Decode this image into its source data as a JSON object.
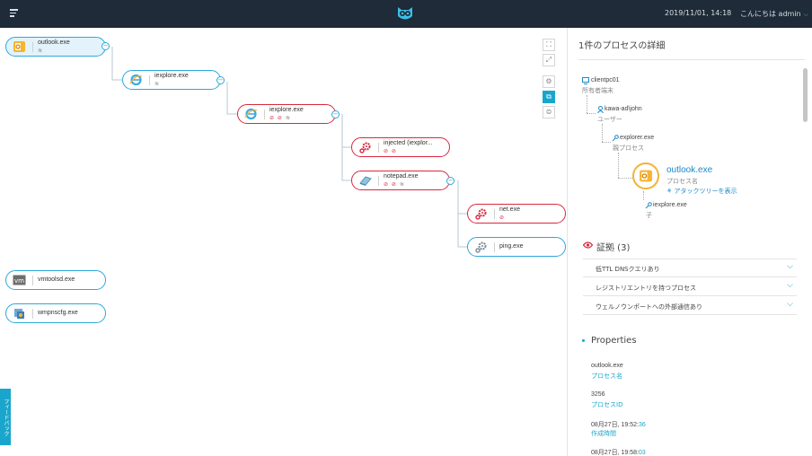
{
  "header": {
    "datetime": "2019/11/01, 14:18",
    "greeting": "こんにちは admin",
    "caret": "⌵"
  },
  "icons": {
    "menu": "menu-icon",
    "logo": "owl-logo-icon",
    "outlook": "outlook-icon",
    "ie": "internet-explorer-icon",
    "gear": "gear-icon",
    "notepad": "notepad-icon",
    "vm": "vm-icon",
    "network": "network-icon",
    "monitor": "monitor-icon",
    "user": "user-icon",
    "key": "key-icon",
    "eye": "eye-icon",
    "tree": "tree-icon"
  },
  "colors": {
    "topbar": "#1f2b38",
    "blue": "#2ba8db",
    "red": "#d8283e",
    "accent": "#1aa6cc",
    "link": "#1a88c9"
  },
  "graph": {
    "nodes": [
      {
        "label": "outlook.exe",
        "badges": ""
      },
      {
        "label": "iexplore.exe",
        "badges": ""
      },
      {
        "label": "iexplore.exe",
        "badges": "⊘ ⊘"
      },
      {
        "label": "injected (iexplor...",
        "badges": "⊘ ⊘"
      },
      {
        "label": "notepad.exe",
        "badges": "⊘ ⊘"
      },
      {
        "label": "net.exe",
        "badges": "⊘"
      },
      {
        "label": "ping.exe",
        "badges": ""
      },
      {
        "label": "vmtoolsd.exe",
        "badges": ""
      },
      {
        "label": "wmpnscfg.exe",
        "badges": ""
      }
    ],
    "collapse_symbol": "−",
    "vm_text": "vm"
  },
  "tools": [
    "⛶",
    "⤢",
    "⚙",
    "⧉",
    "⊜"
  ],
  "feedback": "フィードバック",
  "panel": {
    "title": "1件のプロセスの詳細",
    "host": {
      "value": "clientpc01",
      "label": "所有者端末"
    },
    "user": {
      "value": "kawa-ad\\john",
      "label": "ユーザー"
    },
    "parent": {
      "value": "explorer.exe",
      "label": "親プロセス"
    },
    "process": {
      "name": "outlook.exe",
      "label": "プロセス名",
      "link": "アタックツリーを表示"
    },
    "child": {
      "value": "iexplore.exe",
      "label": "子"
    },
    "evidence": {
      "title": "証拠 (3)",
      "items": [
        "低TTL DNSクエリあり",
        "レジストリエントリを持つプロセス",
        "ウェルノウンポートへの外部通信あり"
      ]
    },
    "properties": {
      "title": "Properties",
      "rows": [
        {
          "value": "outlook.exe",
          "label": "プロセス名"
        },
        {
          "value": "3256",
          "label": "プロセスID"
        },
        {
          "value": "08月27日, 19:52:",
          "value_hl": "36",
          "label": "作成時間"
        },
        {
          "value": "08月27日, 19:58:",
          "value_hl": "03",
          "label": ""
        }
      ]
    }
  }
}
